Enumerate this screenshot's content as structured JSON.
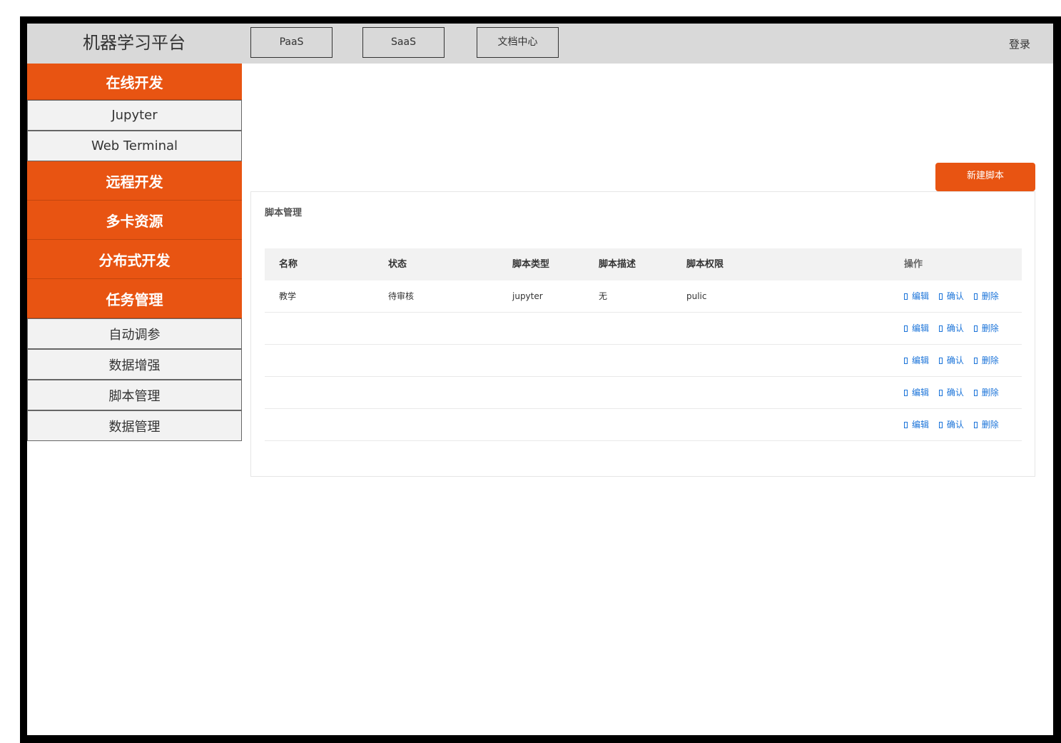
{
  "app": {
    "title": "机器学习平台",
    "login_label": "登录"
  },
  "top_nav": [
    {
      "label": "PaaS"
    },
    {
      "label": "SaaS"
    },
    {
      "label": "文档中心"
    }
  ],
  "sidebar": {
    "items": [
      {
        "label": "在线开发"
      },
      {
        "label": "Jupyter"
      },
      {
        "label": "Web Terminal"
      },
      {
        "label": "远程开发"
      },
      {
        "label": "多卡资源"
      },
      {
        "label": "分布式开发"
      },
      {
        "label": "任务管理"
      },
      {
        "label": "自动调参"
      },
      {
        "label": "数据增强"
      },
      {
        "label": "脚本管理"
      },
      {
        "label": "数据管理"
      }
    ]
  },
  "main": {
    "new_button_label": "新建脚本",
    "panel_title": "脚本管理",
    "table": {
      "columns": [
        "名称",
        "状态",
        "脚本类型",
        "脚本描述",
        "脚本权限",
        "操作"
      ],
      "actions": {
        "edit": "编辑",
        "confirm": "确认",
        "delete": "删除"
      },
      "rows": [
        [
          "教学",
          "待审核",
          "jupyter",
          "无",
          "pulic"
        ],
        [
          "",
          "",
          "",
          "",
          ""
        ],
        [
          "",
          "",
          "",
          "",
          ""
        ],
        [
          "",
          "",
          "",
          "",
          ""
        ],
        [
          "",
          "",
          "",
          "",
          ""
        ]
      ]
    }
  },
  "colors": {
    "accent": "#e85412",
    "header_bg": "#d9d9d9",
    "link": "#1a73d9",
    "sub_item_bg": "#f2f2f2"
  }
}
